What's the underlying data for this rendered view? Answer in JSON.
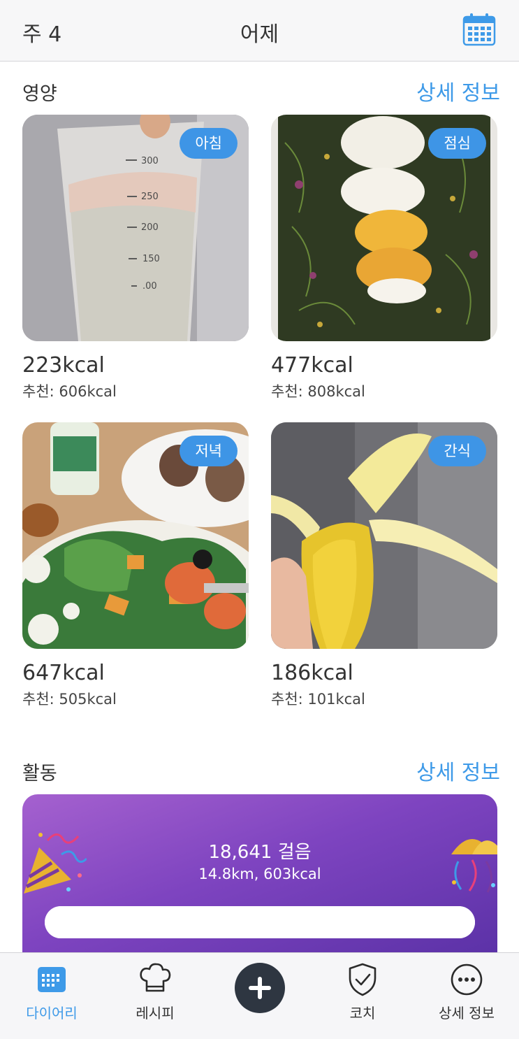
{
  "header": {
    "week": "주 4",
    "title": "어제",
    "calendar_icon": "calendar-icon"
  },
  "nutrition": {
    "label": "영양",
    "more": "상세 정보",
    "meals": [
      {
        "tag": "아침",
        "kcal": "223kcal",
        "recommended": "추천: 606kcal"
      },
      {
        "tag": "점심",
        "kcal": "477kcal",
        "recommended": "추천: 808kcal"
      },
      {
        "tag": "저녁",
        "kcal": "647kcal",
        "recommended": "추천: 505kcal"
      },
      {
        "tag": "간식",
        "kcal": "186kcal",
        "recommended": "추천: 101kcal"
      }
    ]
  },
  "activity": {
    "label": "활동",
    "more": "상세 정보",
    "steps": "18,641 걸음",
    "summary": "14.8km, 603kcal",
    "progress": 1.0
  },
  "tabbar": {
    "items": [
      {
        "label": "다이어리",
        "icon": "diary-calendar-icon",
        "active": true
      },
      {
        "label": "레시피",
        "icon": "chef-hat-icon",
        "active": false
      },
      {
        "label": "",
        "icon": "plus-icon",
        "active": false
      },
      {
        "label": "코치",
        "icon": "shield-check-icon",
        "active": false
      },
      {
        "label": "상세 정보",
        "icon": "more-dots-icon",
        "active": false
      }
    ]
  },
  "colors": {
    "accent": "#3e9ae8",
    "tag": "#3e95e6",
    "activity_gradient": [
      "#a561cf",
      "#5a31a6"
    ],
    "add_button": "#2e3641"
  }
}
